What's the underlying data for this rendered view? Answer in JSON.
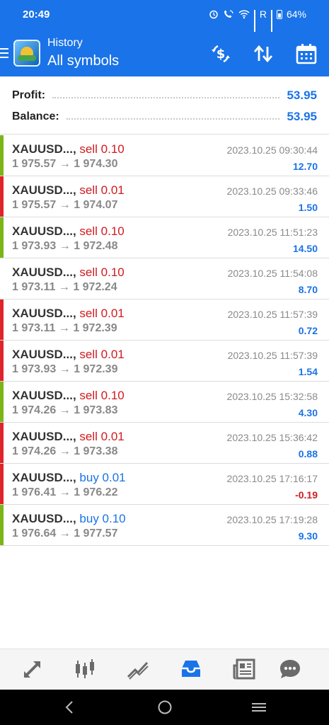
{
  "status_bar": {
    "time": "20:49",
    "network_r": "R",
    "battery": "64%"
  },
  "app_bar": {
    "title": "History",
    "subtitle": "All symbols",
    "icons": [
      "menu-icon",
      "app-logo",
      "currency-exchange-icon",
      "sort-icon",
      "calendar-icon"
    ]
  },
  "summary": {
    "profit_label": "Profit:",
    "profit_value": "53.95",
    "balance_label": "Balance:",
    "balance_value": "53.95"
  },
  "deals": [
    {
      "symbol": "XAUUSD...,",
      "type": "sell",
      "volume": "sell 0.10",
      "open": "1 975.57",
      "close": "1 974.30",
      "time": "2023.10.25 09:30:44",
      "profit": "12.70",
      "bar_color": "#7cb518"
    },
    {
      "symbol": "XAUUSD...,",
      "type": "sell",
      "volume": "sell 0.01",
      "open": "1 975.57",
      "close": "1 974.07",
      "time": "2023.10.25 09:33:46",
      "profit": "1.50",
      "bar_color": "#e0242b"
    },
    {
      "symbol": "XAUUSD...,",
      "type": "sell",
      "volume": "sell 0.10",
      "open": "1 973.93",
      "close": "1 972.48",
      "time": "2023.10.25 11:51:23",
      "profit": "14.50",
      "bar_color": "#7cb518"
    },
    {
      "symbol": "XAUUSD...,",
      "type": "sell",
      "volume": "sell 0.10",
      "open": "1 973.11",
      "close": "1 972.24",
      "time": "2023.10.25 11:54:08",
      "profit": "8.70",
      "bar_color": ""
    },
    {
      "symbol": "XAUUSD...,",
      "type": "sell",
      "volume": "sell 0.01",
      "open": "1 973.11",
      "close": "1 972.39",
      "time": "2023.10.25 11:57:39",
      "profit": "0.72",
      "bar_color": "#e0242b"
    },
    {
      "symbol": "XAUUSD...,",
      "type": "sell",
      "volume": "sell 0.01",
      "open": "1 973.93",
      "close": "1 972.39",
      "time": "2023.10.25 11:57:39",
      "profit": "1.54",
      "bar_color": "#e0242b"
    },
    {
      "symbol": "XAUUSD...,",
      "type": "sell",
      "volume": "sell 0.10",
      "open": "1 974.26",
      "close": "1 973.83",
      "time": "2023.10.25 15:32:58",
      "profit": "4.30",
      "bar_color": "#7cb518"
    },
    {
      "symbol": "XAUUSD...,",
      "type": "sell",
      "volume": "sell 0.01",
      "open": "1 974.26",
      "close": "1 973.38",
      "time": "2023.10.25 15:36:42",
      "profit": "0.88",
      "bar_color": "#e0242b"
    },
    {
      "symbol": "XAUUSD...,",
      "type": "buy",
      "volume": "buy 0.01",
      "open": "1 976.41",
      "close": "1 976.22",
      "time": "2023.10.25 17:16:17",
      "profit": "-0.19",
      "bar_color": "#e0242b"
    },
    {
      "symbol": "XAUUSD...,",
      "type": "buy",
      "volume": "buy 0.10",
      "open": "1 976.64",
      "close": "1 977.57",
      "time": "2023.10.25 17:19:28",
      "profit": "9.30",
      "bar_color": "#7cb518"
    }
  ],
  "arrow_glyph": "→",
  "bottom_nav": [
    {
      "name": "quotes",
      "icon": "quotes-arrows-icon",
      "active": false
    },
    {
      "name": "chart",
      "icon": "candlestick-chart-icon",
      "active": false
    },
    {
      "name": "trade",
      "icon": "trade-line-icon",
      "active": false
    },
    {
      "name": "history",
      "icon": "inbox-tray-icon",
      "active": true
    },
    {
      "name": "news",
      "icon": "newspaper-icon",
      "active": false
    },
    {
      "name": "chat",
      "icon": "chat-bubble-icon",
      "active": false
    }
  ],
  "system_nav": [
    "back-icon",
    "home-icon",
    "recents-icon"
  ],
  "colors": {
    "accent": "#1a73e8",
    "sell": "#d01a20",
    "profit_bar": "#7cb518",
    "loss_bar": "#e0242b",
    "nav_icon": "#6a6a6a"
  }
}
